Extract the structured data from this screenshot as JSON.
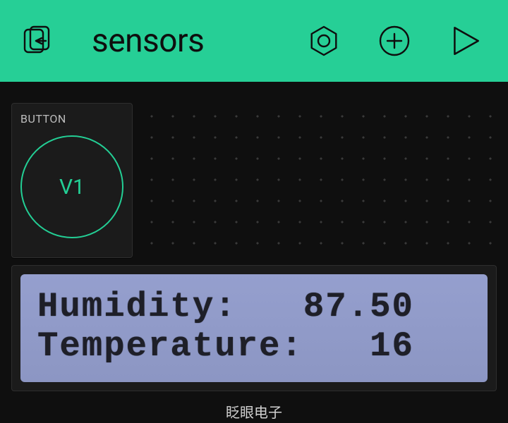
{
  "header": {
    "title": "sensors"
  },
  "widgets": {
    "button": {
      "label": "BUTTON",
      "pin": "V1"
    },
    "lcd": {
      "line1": "Humidity:   87.50",
      "line2": "Temperature:   16"
    }
  },
  "footer": {
    "text": "眨眼电子"
  },
  "colors": {
    "accent": "#26cf96",
    "lcd_bg": "#929cc9",
    "lcd_text": "#1e1f28"
  }
}
